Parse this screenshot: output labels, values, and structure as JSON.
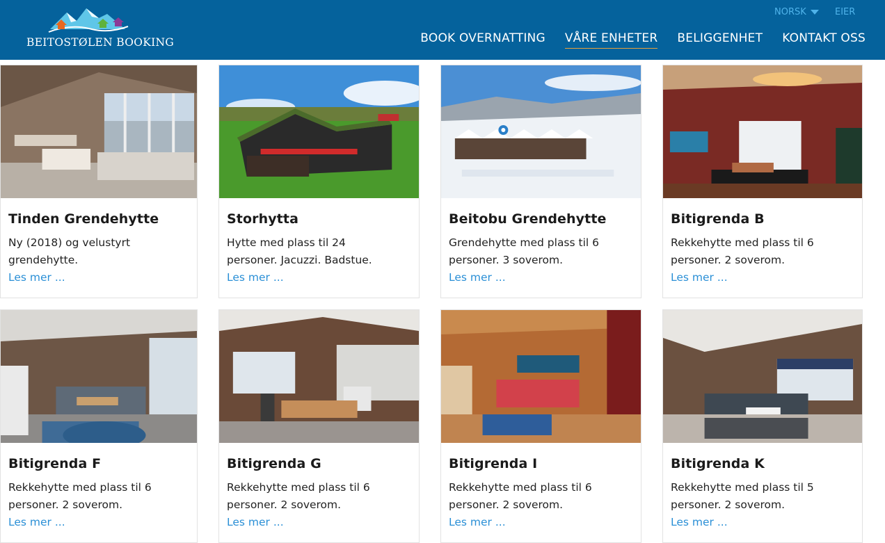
{
  "header": {
    "logo_text": "BEITOSTØLEN BOOKING",
    "language": "NORSK",
    "owner": "EIER",
    "nav": [
      {
        "label": "BOOK OVERNATTING",
        "active": false
      },
      {
        "label": "VÅRE ENHETER",
        "active": true
      },
      {
        "label": "BELIGGENHET",
        "active": false
      },
      {
        "label": "KONTAKT OSS",
        "active": false
      }
    ]
  },
  "colors": {
    "header_bg": "#05629c",
    "link": "#2a8fd6",
    "accent_underline": "#e8a13a"
  },
  "units": [
    {
      "title": "Tinden Grendehytte",
      "desc": "Ny (2018) og velustyrt grendehytte.",
      "link": "Les mer ...",
      "image": "living-room-photo"
    },
    {
      "title": "Storhytta",
      "desc": "Hytte med plass til 24 personer. Jacuzzi. Badstue.",
      "link": "Les mer ...",
      "image": "cabin-exterior-photo"
    },
    {
      "title": "Beitobu Grendehytte",
      "desc": "Grendehytte med plass til 6 personer. 3 soverom.",
      "link": "Les mer ...",
      "image": "winter-aerial-photo"
    },
    {
      "title": "Bitigrenda B",
      "desc": "Rekkehytte med plass til 6 personer. 2 soverom.",
      "link": "Les mer ...",
      "image": "red-living-room-photo"
    },
    {
      "title": "Bitigrenda F",
      "desc": "Rekkehytte med plass til 6 personer. 2 soverom.",
      "link": "Les mer ...",
      "image": "living-room-photo"
    },
    {
      "title": "Bitigrenda G",
      "desc": "Rekkehytte med plass til 6 personer. 2 soverom.",
      "link": "Les mer ...",
      "image": "kitchen-photo"
    },
    {
      "title": "Bitigrenda I",
      "desc": "Rekkehytte med plass til 6 personer. 2 soverom.",
      "link": "Les mer ...",
      "image": "red-sofa-room-photo"
    },
    {
      "title": "Bitigrenda K",
      "desc": "Rekkehytte med plass til 5 personer. 2 soverom.",
      "link": "Les mer ...",
      "image": "living-room-photo"
    }
  ]
}
